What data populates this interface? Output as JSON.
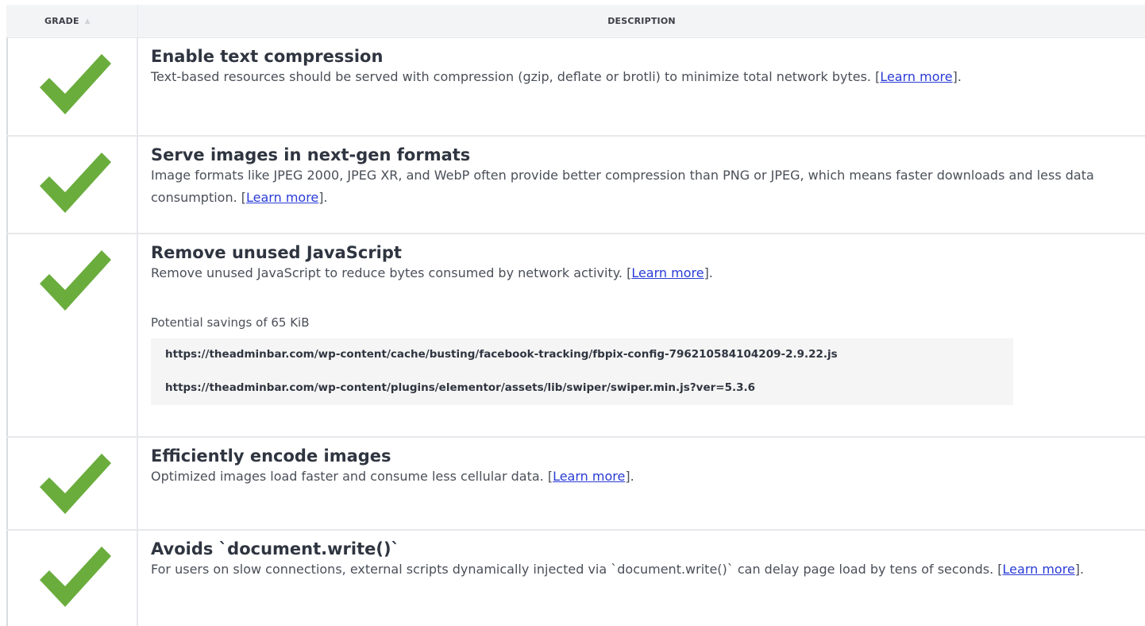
{
  "header": {
    "grade_label": "GRADE",
    "sort_glyph": "▲",
    "description_label": "DESCRIPTION"
  },
  "colors": {
    "check": "#6aad3d",
    "link": "#2a3bd6"
  },
  "rows": [
    {
      "grade_icon": "checkmark-icon",
      "title": "Enable text compression",
      "text": "Text-based resources should be served with compression (gzip, deflate or brotli) to minimize total network bytes. [",
      "link": "Learn more",
      "after": "]."
    },
    {
      "grade_icon": "checkmark-icon",
      "title": "Serve images in next-gen formats",
      "text": "Image formats like JPEG 2000, JPEG XR, and WebP often provide better compression than PNG or JPEG, which means faster downloads and less data consumption. [",
      "link": "Learn more",
      "after": "]."
    },
    {
      "grade_icon": "checkmark-icon",
      "title": "Remove unused JavaScript",
      "text": "Remove unused JavaScript to reduce bytes consumed by network activity. [",
      "link": "Learn more",
      "after": "].",
      "savings": "Potential savings of 65 KiB",
      "urls": [
        "https://theadminbar.com/wp-content/cache/busting/facebook-tracking/fbpix-config-796210584104209-2.9.22.js",
        "https://theadminbar.com/wp-content/plugins/elementor/assets/lib/swiper/swiper.min.js?ver=5.3.6"
      ]
    },
    {
      "grade_icon": "checkmark-icon",
      "title": "Efficiently encode images",
      "text": "Optimized images load faster and consume less cellular data. [",
      "link": "Learn more",
      "after": "]."
    },
    {
      "grade_icon": "checkmark-icon",
      "title": "Avoids `document.write()`",
      "text": "For users on slow connections, external scripts dynamically injected via `document.write()` can delay page load by tens of seconds. [",
      "link": "Learn more",
      "after": "]."
    }
  ]
}
